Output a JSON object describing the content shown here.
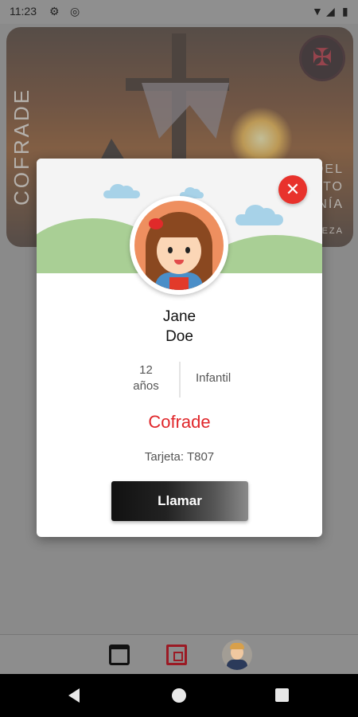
{
  "status_bar": {
    "time": "11:23",
    "icons": [
      "gear-icon",
      "nfc-icon",
      "wifi-icon",
      "signal-icon",
      "battery-icon"
    ]
  },
  "hero": {
    "vertical_label": "COFRADE",
    "right_lines": [
      "DEL",
      "STO",
      "NÍA",
      "EZA"
    ]
  },
  "modal": {
    "close_label": "✕",
    "first_name": "Jane",
    "last_name": "Doe",
    "age_value": "12",
    "age_unit": "años",
    "category": "Infantil",
    "role": "Cofrade",
    "card_text": "Tarjeta: T807",
    "call_label": "Llamar"
  },
  "bottom_nav": {
    "items": [
      "calendar-icon",
      "card-icon",
      "profile-avatar"
    ]
  },
  "colors": {
    "accent_red": "#e0262a",
    "close_red": "#e8322c",
    "hill_green": "#a9cf95",
    "cloud_blue": "#a7d2e8"
  }
}
